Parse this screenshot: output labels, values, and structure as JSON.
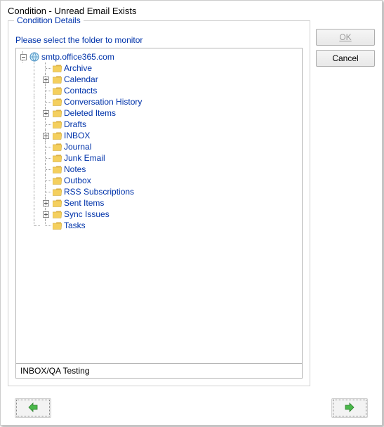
{
  "window_title": "Condition - Unread Email  Exists",
  "fieldset_legend": "Condition Details",
  "prompt": "Please select the folder to monitor",
  "root_node": {
    "label": "smtp.office365.com",
    "expanded": true
  },
  "folders": [
    {
      "label": "Archive",
      "expandable": false
    },
    {
      "label": "Calendar",
      "expandable": true
    },
    {
      "label": "Contacts",
      "expandable": false
    },
    {
      "label": "Conversation History",
      "expandable": false
    },
    {
      "label": "Deleted Items",
      "expandable": true
    },
    {
      "label": "Drafts",
      "expandable": false
    },
    {
      "label": "INBOX",
      "expandable": true
    },
    {
      "label": "Journal",
      "expandable": false
    },
    {
      "label": "Junk Email",
      "expandable": false
    },
    {
      "label": "Notes",
      "expandable": false
    },
    {
      "label": "Outbox",
      "expandable": false
    },
    {
      "label": "RSS Subscriptions",
      "expandable": false
    },
    {
      "label": "Sent Items",
      "expandable": true
    },
    {
      "label": "Sync Issues",
      "expandable": true
    },
    {
      "label": "Tasks",
      "expandable": false
    }
  ],
  "selected_path": "INBOX/QA Testing",
  "buttons": {
    "ok": "OK",
    "cancel": "Cancel"
  }
}
